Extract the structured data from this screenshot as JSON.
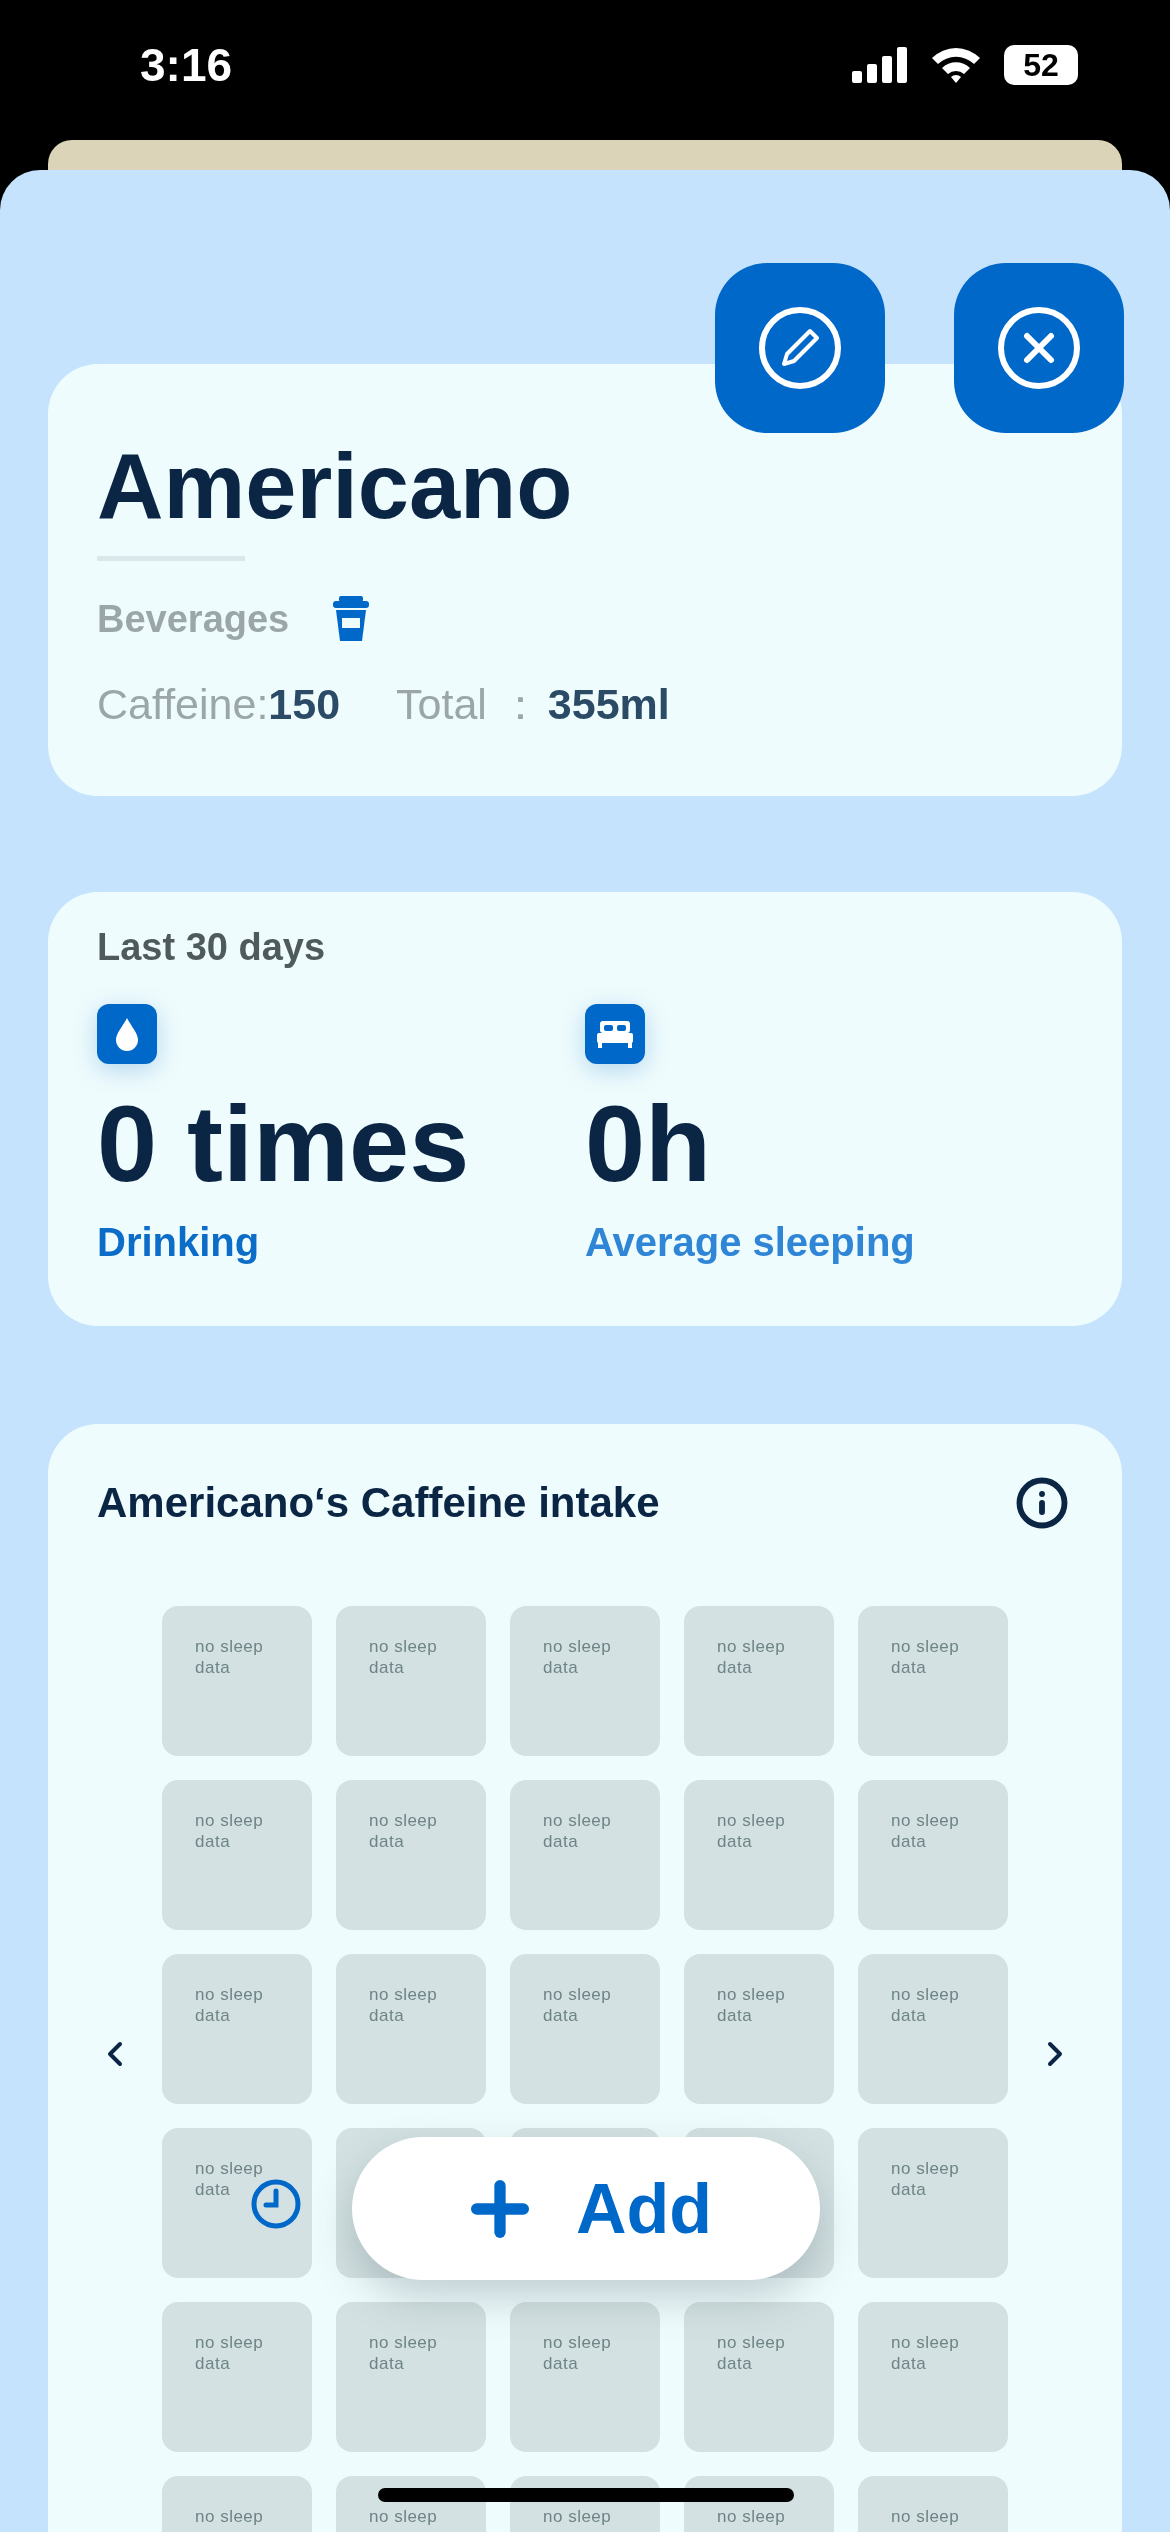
{
  "status_bar": {
    "time": "3:16",
    "battery": "52"
  },
  "actions": [
    {
      "kind": "edit"
    },
    {
      "kind": "close"
    }
  ],
  "drink": {
    "name": "Americano",
    "category": "Beverages",
    "caffeine_label": "Caffeine:",
    "caffeine_value": "150",
    "total_label": "Total ：",
    "total_value": "355ml"
  },
  "summary": {
    "title": "Last 30 days",
    "stats": [
      {
        "kind": "drinking",
        "value": "0 times",
        "label": "Drinking"
      },
      {
        "kind": "sleeping",
        "value": "0h",
        "label": "Average sleeping"
      }
    ]
  },
  "intake": {
    "title": "Americano‘s Caffeine intake",
    "rows": [
      [
        {
          "text": "no sleep data"
        },
        {
          "text": "no sleep data"
        },
        {
          "text": "no sleep data"
        },
        {
          "text": "no sleep data"
        },
        {
          "text": "no sleep data"
        }
      ],
      [
        {
          "text": "no sleep data"
        },
        {
          "text": "no sleep data"
        },
        {
          "text": "no sleep data"
        },
        {
          "text": "no sleep data"
        },
        {
          "text": "no sleep data"
        }
      ],
      [
        {
          "text": "no sleep data"
        },
        {
          "text": "no sleep data"
        },
        {
          "text": "no sleep data"
        },
        {
          "text": "no sleep data"
        },
        {
          "text": "no sleep data"
        }
      ],
      [
        {
          "text": "no sleep data"
        },
        {},
        {},
        {},
        {
          "text": "no sleep data"
        }
      ],
      [
        {
          "text": "no sleep data"
        },
        {
          "text": "no sleep data"
        },
        {
          "text": "no sleep data"
        },
        {
          "text": "no sleep data"
        },
        {
          "text": "no sleep data"
        }
      ],
      [
        {
          "text": "no sleep"
        },
        {
          "text": "no sleep"
        },
        {
          "text": "no sleep"
        },
        {
          "text": "no sleep"
        },
        {
          "text": "no sleep"
        }
      ]
    ]
  },
  "add_button": {
    "label": "Add"
  }
}
